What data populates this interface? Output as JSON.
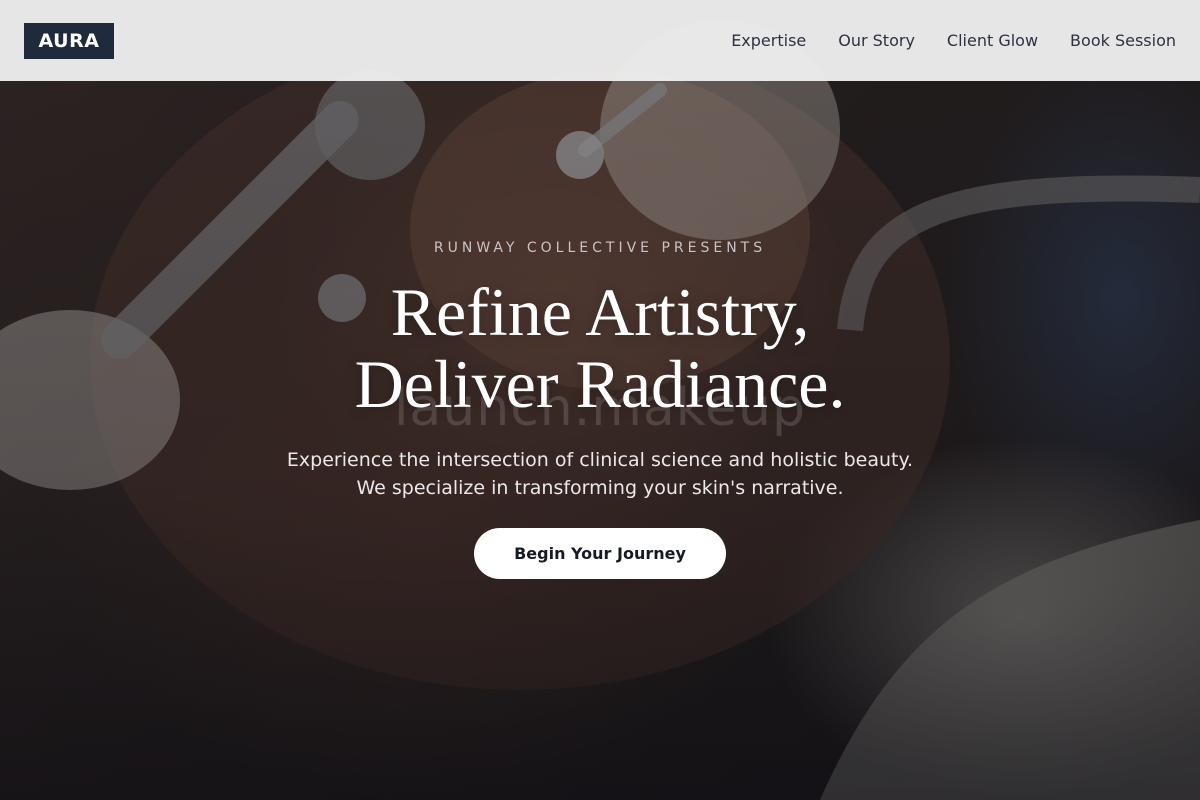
{
  "brand": {
    "logo": "AURA"
  },
  "nav": {
    "items": [
      {
        "label": "Expertise"
      },
      {
        "label": "Our Story"
      },
      {
        "label": "Client Glow"
      },
      {
        "label": "Book Session"
      }
    ]
  },
  "hero": {
    "eyebrow": "RUNWAY COLLECTIVE PRESENTS",
    "headline_line1": "Refine Artistry,",
    "headline_line2": "Deliver Radiance.",
    "subtext_line1": "Experience the intersection of clinical science and holistic beauty.",
    "subtext_line2": "We specialize in transforming your skin's narrative.",
    "cta_label": "Begin Your Journey",
    "watermark": "launch.makeup"
  },
  "colors": {
    "logo_bg": "#1f2a3c",
    "nav_bg": "#eeeeee",
    "cta_bg": "#ffffff",
    "cta_text": "#161a26"
  }
}
